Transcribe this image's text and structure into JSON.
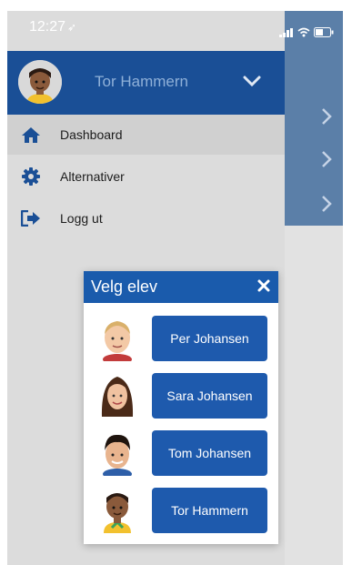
{
  "status": {
    "time": "12:27",
    "location_arrow": "➶"
  },
  "drawer": {
    "user_name": "Tor Hammern",
    "menu": [
      {
        "label": "Dashboard",
        "icon": "home-icon"
      },
      {
        "label": "Alternativer",
        "icon": "gear-icon"
      },
      {
        "label": "Logg ut",
        "icon": "logout-icon"
      }
    ]
  },
  "modal": {
    "title": "Velg elev",
    "close_glyph": "×",
    "students": [
      {
        "name": "Per Johansen",
        "avatar": "blond-boy-avatar"
      },
      {
        "name": "Sara Johansen",
        "avatar": "girl-avatar"
      },
      {
        "name": "Tom Johansen",
        "avatar": "dark-hair-boy-avatar"
      },
      {
        "name": "Tor Hammern",
        "avatar": "cartoon-boy-avatar"
      }
    ]
  },
  "colors": {
    "header_blue": "#1a4f96",
    "button_blue": "#1e5aad",
    "side_panel": "#5b7fa8",
    "overlay_gray": "#e2e2e2"
  }
}
